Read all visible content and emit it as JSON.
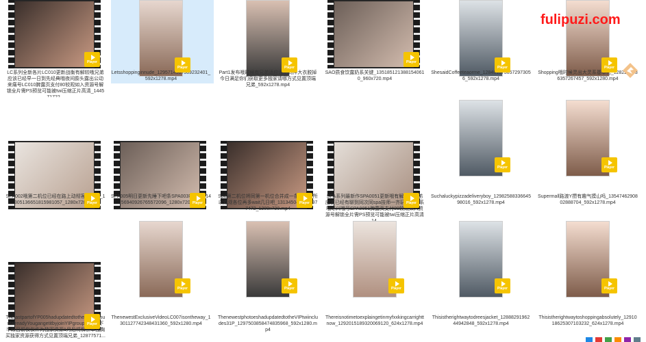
{
  "watermark": "fulipuzi.com",
  "badge_label": "Player",
  "icons": [
    "play-icon",
    "bird-icon"
  ],
  "items": [
    {
      "label": "LC系列全新各片LC010更新战衡有解较哦兄弟应该已经早一日到先经典哦夜间膨头露出公动来痛号LC010脾露页支付80较观如入资源号解锁全片需PS预览可能被twi压缩正片高清_144571722...",
      "type": "film"
    },
    {
      "label": "Letsshoppinginnude_1295714567369232401_592x1278.mp4",
      "type": "port"
    },
    {
      "label": "Part1发布哦时候有兄弟适应设把同件大衣脱掉今日满足你们获取更多独家请哪方式见置顶端兄弟_592x1278.mp4",
      "type": "port"
    },
    {
      "label": "SAO质食饮露奶系关键_1351851213881540610_960x720.mp4",
      "type": "film"
    },
    {
      "label": "ShesaidCoffeeteaorme_1284813736572973056_592x1278.mp4",
      "type": "port"
    },
    {
      "label": "Shopping哦时候灵出大灵系基本礼_1282281636357267457_592x1280.mp4",
      "type": "port"
    },
    {
      "label": "SPA002哦第二机位已经在路上动彻客清明待_1305136651815981057_1280x720.mp4",
      "type": "film"
    },
    {
      "label": "SPA005明日更新先睡下吧条SPA003哪哪身_1456940926765572096_1280x720.mp4",
      "type": "film"
    },
    {
      "label": "Spa第二机位将同第一机位合并成一条片发布所以观观各位再多wait几日吧_1313450431519977472_1280x720.mp4",
      "type": "film"
    },
    {
      "label": "SPA系列最新作SPA0051更新哦有解较哦兄弟应该已经有聊到同次同spa技师一齐玩老婆就系哦尽兴哦号SPA0051脾露页支付80较观如入资源号解锁全片需PS预览可能被twi压缩正片高清_14...",
      "type": "film"
    },
    {
      "label": "Suchaluckypizzadeliveryboy_1298258833664598016_592x1278.mp4",
      "type": "port"
    },
    {
      "label": "Supermall路渡Y攒有趣气摸山吗_1354746290802888704_592x1278.mp4",
      "type": "port"
    },
    {
      "label": "ThelastpartofYP005hadupdatedtotheYIPAccountalreadyYougangetitbyjoinYIPgroupYP005下半段目前仅仅作为独家资源1月后将解禁草独胸买独家资源获得方式见置顶端兄弟_12877571...",
      "type": "film"
    },
    {
      "label": "ThenewestExclusiveVideoLC007isontheway_1301127742348431360_592x1280.mp4",
      "type": "port"
    },
    {
      "label": "ThenewestphotoeshadupdatedtotheVIPtwiincludes31P_1297503858474835968_592x1280.mp4",
      "type": "port"
    },
    {
      "label": "Thereisnotimetoexplaingetinmyfxxkingcarrighttnow_1292015189320069120_624x1278.mp4",
      "type": "port"
    },
    {
      "label": "Thisistherightwaytodreesjacket_1288829196244942848_592x1278.mp4",
      "type": "port"
    },
    {
      "label": "Thisistherightwaytoshoppingabsolutely_1291018625307103232_624x1278.mp4",
      "type": "port"
    }
  ]
}
